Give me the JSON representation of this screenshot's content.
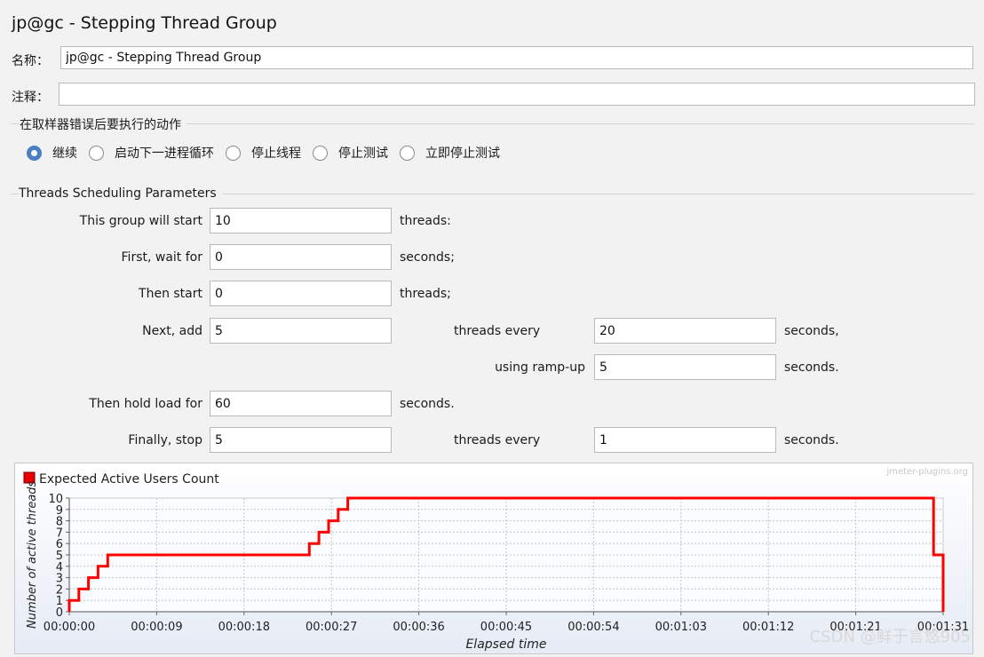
{
  "title": "jp@gc - Stepping Thread Group",
  "name_label": "名称：",
  "name_value": "jp@gc - Stepping Thread Group",
  "comment_label": "注释：",
  "comment_value": "",
  "error_action": {
    "section_title": "在取样器错误后要执行的动作",
    "options": [
      "继续",
      "启动下一进程循环",
      "停止线程",
      "停止测试",
      "立即停止测试"
    ],
    "selected": "继续"
  },
  "params": {
    "section_title": "Threads Scheduling Parameters",
    "start_label": "This group will start",
    "start_value": "10",
    "start_unit": "threads:",
    "wait_label": "First, wait for",
    "wait_value": "0",
    "wait_unit": "seconds;",
    "then_start_label": "Then start",
    "then_start_value": "0",
    "then_start_unit": "threads;",
    "next_add_label": "Next, add",
    "next_add_value": "5",
    "next_add_mid": "threads every",
    "next_add_every_value": "20",
    "next_add_unit": "seconds,",
    "rampup_label": "using ramp-up",
    "rampup_value": "5",
    "rampup_unit": "seconds.",
    "hold_label": "Then hold load for",
    "hold_value": "60",
    "hold_unit": "seconds.",
    "stop_label": "Finally, stop",
    "stop_value": "5",
    "stop_mid": "threads every",
    "stop_every_value": "1",
    "stop_unit": "seconds."
  },
  "chart_data": {
    "type": "line",
    "legend": "Expected Active Users Count",
    "watermark": "jmeter-plugins.org",
    "ylabel": "Number of active threads",
    "xlabel": "Elapsed time",
    "ylim": [
      0,
      10
    ],
    "xlim": [
      0,
      91
    ],
    "y_ticks": [
      "0",
      "1",
      "2",
      "3",
      "4",
      "5",
      "6",
      "7",
      "8",
      "9",
      "10"
    ],
    "x_ticks": [
      "00:00:00",
      "00:00:09",
      "00:00:18",
      "00:00:27",
      "00:00:36",
      "00:00:45",
      "00:00:54",
      "00:01:03",
      "00:01:12",
      "00:01:21",
      "00:01:31"
    ],
    "series": [
      {
        "name": "Expected Active Users Count",
        "color": "#ff0000",
        "x": [
          0,
          0,
          1,
          1,
          2,
          2,
          3,
          3,
          4,
          4,
          5,
          5,
          25,
          25,
          26,
          26,
          27,
          27,
          28,
          28,
          29,
          29,
          30,
          30,
          90,
          90,
          91,
          91
        ],
        "y": [
          0,
          1,
          1,
          2,
          2,
          3,
          3,
          4,
          4,
          5,
          5,
          5,
          5,
          6,
          6,
          7,
          7,
          8,
          8,
          9,
          9,
          10,
          10,
          10,
          10,
          5,
          5,
          0
        ]
      }
    ]
  },
  "footer_watermark": "CSDN @鲜于言悠905"
}
